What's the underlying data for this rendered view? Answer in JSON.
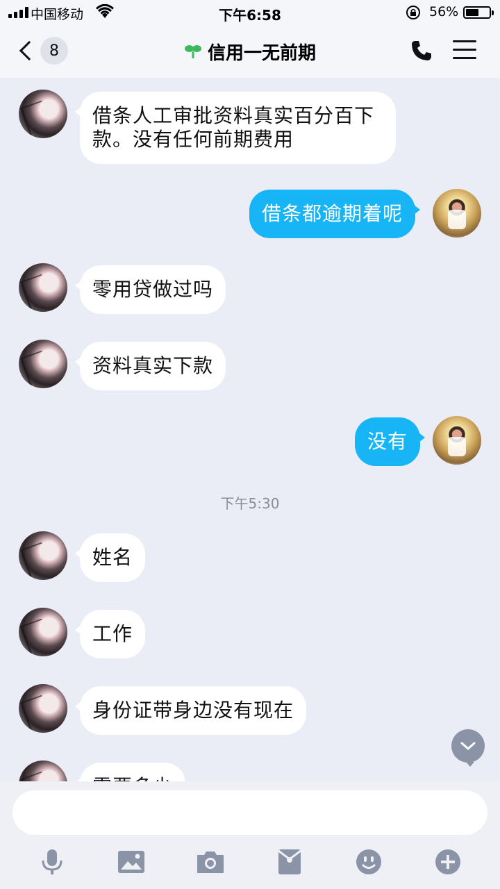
{
  "status_bar": {
    "carrier": "中国移动",
    "time": "下午6:58",
    "battery_percent": "56%",
    "battery_level": 0.56
  },
  "nav": {
    "back_count": "8",
    "title": "信用一无前期",
    "icons": [
      "back-chevron-icon",
      "sprout-icon",
      "phone-icon",
      "menu-icon"
    ]
  },
  "messages": [
    {
      "from": "contact",
      "text": "借条人工审批资料真实百分百下款。没有任何前期费用"
    },
    {
      "from": "me",
      "text": "借条都逾期着呢"
    },
    {
      "from": "contact",
      "text": "零用贷做过吗"
    },
    {
      "from": "contact",
      "text": "资料真实下款"
    },
    {
      "from": "me",
      "text": "没有"
    },
    {
      "from": "contact",
      "text": "姓名"
    },
    {
      "from": "contact",
      "text": "工作"
    },
    {
      "from": "contact",
      "text": "身份证带身边没有现在"
    },
    {
      "from": "contact",
      "text": "需要多少"
    }
  ],
  "time_divider": "下午5:30",
  "input": {
    "placeholder": ""
  },
  "toolbar": [
    "microphone-icon",
    "image-icon",
    "camera-icon",
    "red-packet-icon",
    "emoji-icon",
    "plus-icon"
  ],
  "colors": {
    "outgoing_bubble": "#17b4f6",
    "incoming_bubble": "#ffffff",
    "background": "#eaedf5",
    "toolbar_icon": "#8b93a6"
  }
}
